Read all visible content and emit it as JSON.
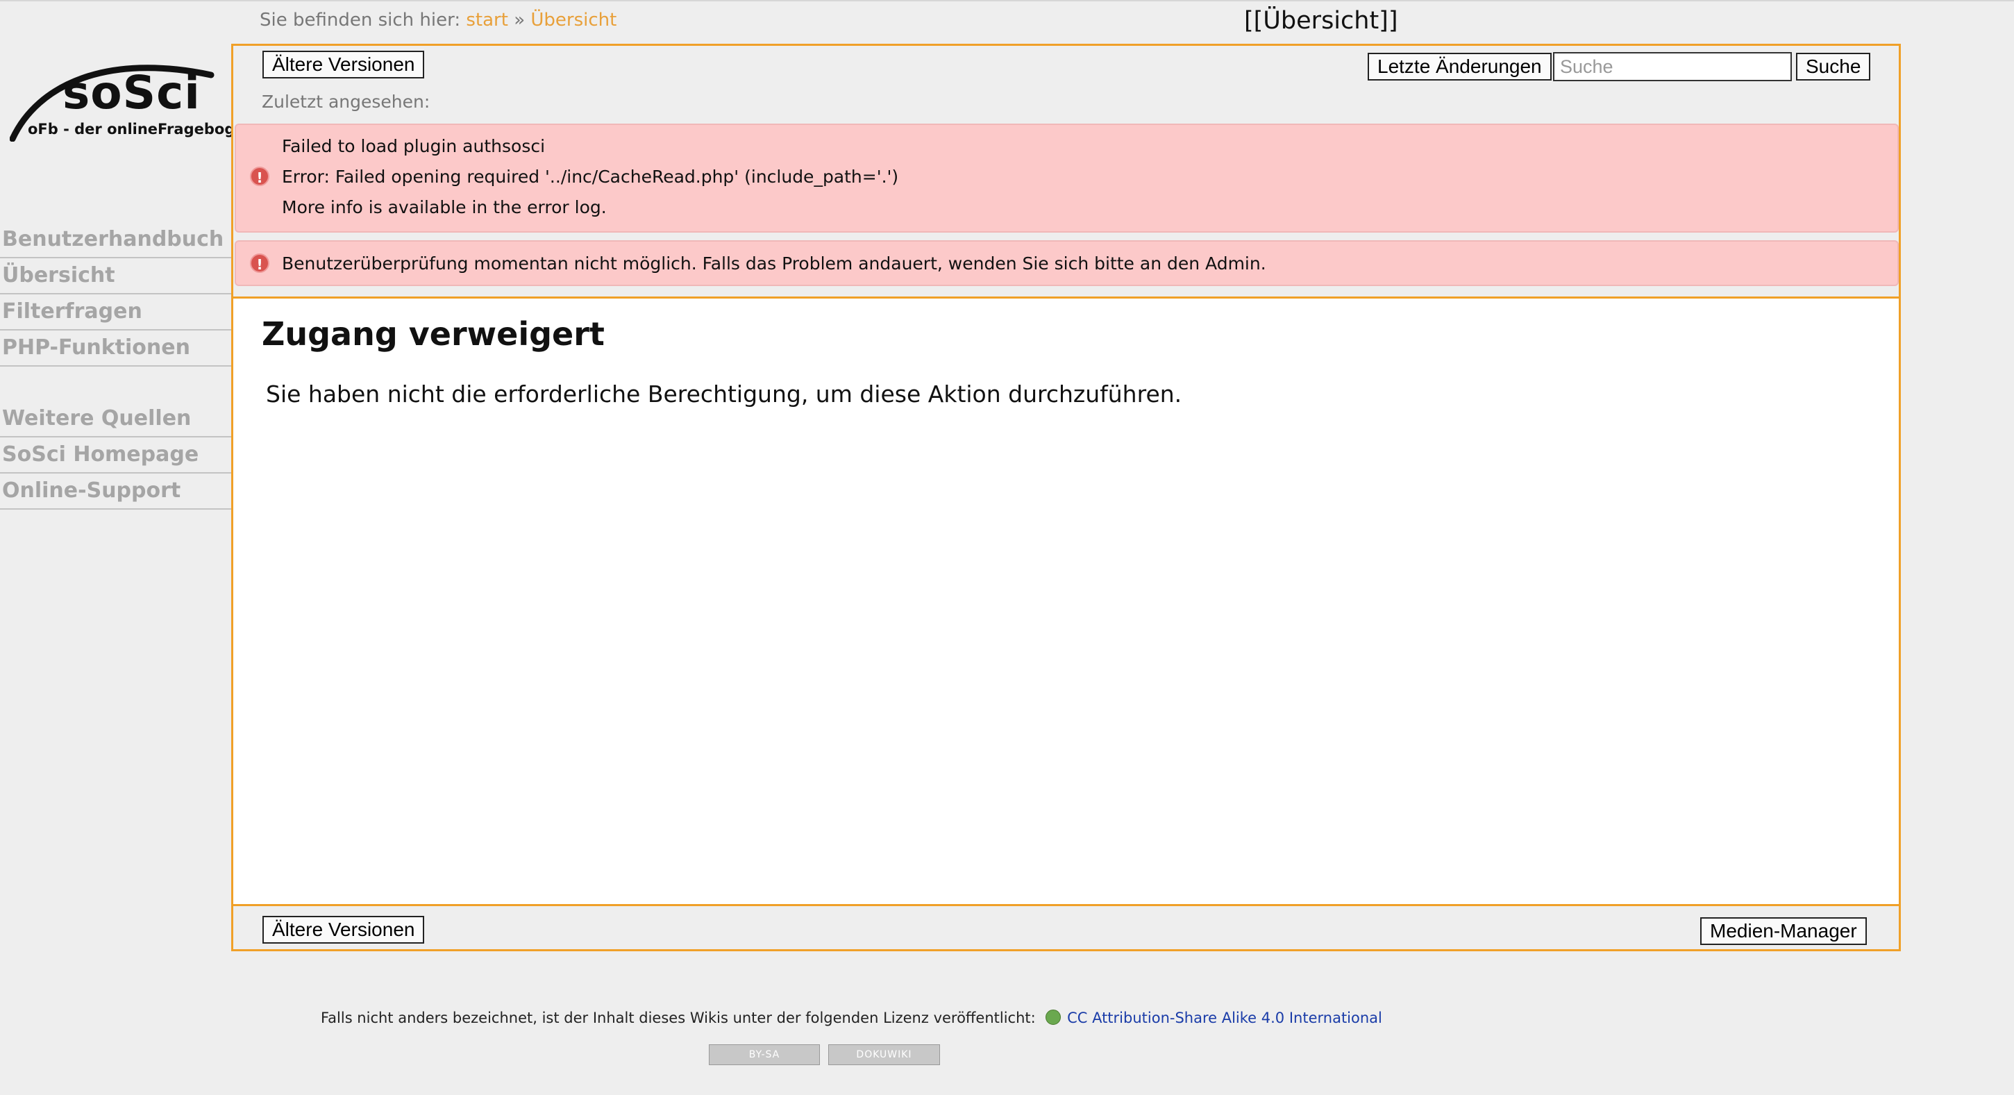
{
  "breadcrumb": {
    "prefix": "Sie befinden sich hier:",
    "items": [
      "start",
      "Übersicht"
    ],
    "separator": "»"
  },
  "page_title": "[[Übersicht]]",
  "logo": {
    "name": "soSci",
    "tagline": "oFb - der onlineFragebogen"
  },
  "sidebar": {
    "section1": [
      "Benutzerhandbuch",
      "Übersicht",
      "Filterfragen",
      "PHP-Funktionen"
    ],
    "section2": [
      "Weitere Quellen",
      "SoSci Homepage",
      "Online-Support"
    ]
  },
  "toolbar": {
    "old_versions": "Ältere Versionen",
    "recent_changes": "Letzte Änderungen",
    "search_placeholder": "Suche",
    "search_button": "Suche"
  },
  "last_seen": "Zuletzt angesehen:",
  "errors": {
    "plugin": [
      "Failed to load plugin authsosci",
      "Error: Failed opening required '../inc/CacheRead.php' (include_path='.')",
      "More info is available in the error log."
    ],
    "auth": "Benutzerüberprüfung momentan nicht möglich. Falls das Problem andauert, wenden Sie sich bitte an den Admin."
  },
  "content": {
    "heading": "Zugang verweigert",
    "message": "Sie haben nicht die erforderliche Berechtigung, um diese Aktion durchzuführen."
  },
  "bottom_toolbar": {
    "old_versions": "Ältere Versionen",
    "media_manager": "Medien-Manager"
  },
  "footer": {
    "license_text": "Falls nicht anders bezeichnet, ist der Inhalt dieses Wikis unter der folgenden Lizenz veröffentlicht:",
    "license_link": "CC Attribution-Share Alike 4.0 International",
    "badges": [
      "BY-SA",
      "DOKUWIKI"
    ]
  },
  "colors": {
    "accent": "#f0a028",
    "error_bg": "#fcc9c9",
    "link": "#e8a03a"
  }
}
